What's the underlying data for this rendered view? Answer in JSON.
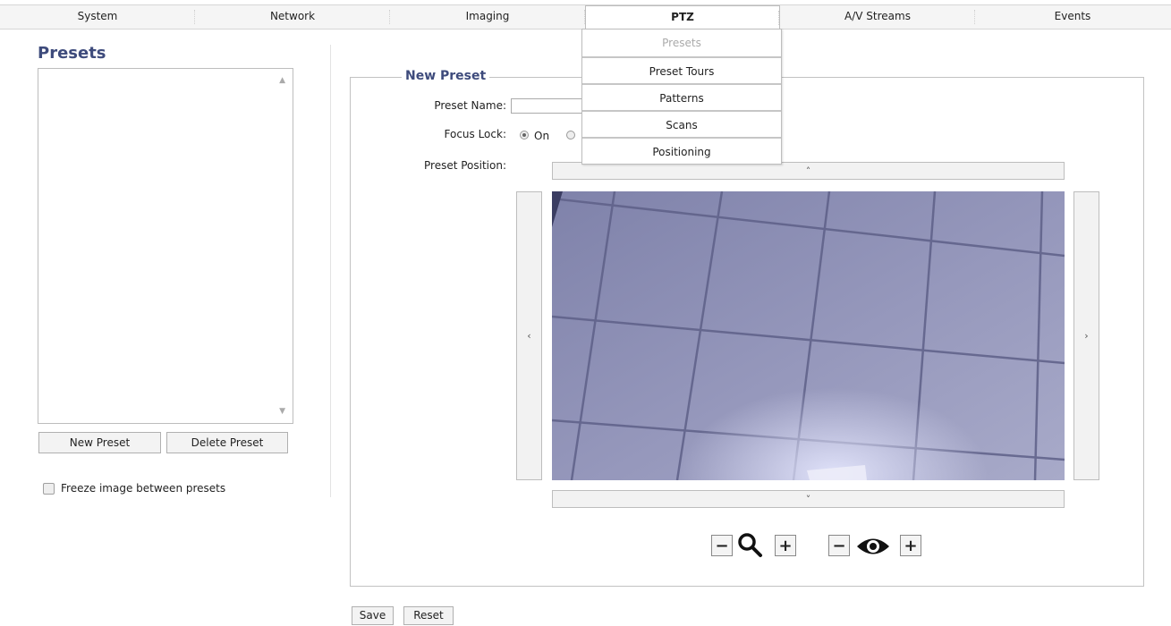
{
  "nav": {
    "tabs": [
      {
        "label": "System"
      },
      {
        "label": "Network"
      },
      {
        "label": "Imaging"
      },
      {
        "label": "PTZ",
        "active": true
      },
      {
        "label": "A/V Streams"
      },
      {
        "label": "Events"
      }
    ]
  },
  "ptz_menu": {
    "items": [
      "Presets",
      "Preset Tours",
      "Patterns",
      "Scans",
      "Positioning"
    ],
    "disabled_item": "Presets"
  },
  "left": {
    "title": "Presets",
    "new_button": "New Preset",
    "delete_button": "Delete Preset",
    "freeze_label": "Freeze image between presets",
    "freeze_checked": false
  },
  "form": {
    "legend": "New Preset",
    "name_label": "Preset Name:",
    "name_value": "",
    "focus_label": "Focus Lock:",
    "focus_on_label": "On",
    "focus_on_selected": true,
    "position_label": "Preset Position:"
  },
  "controls": {
    "up": "˄",
    "down": "˅",
    "left": "‹",
    "right": "›",
    "minus": "−",
    "plus": "+",
    "zoom_icon": "magnifier-icon",
    "focus_icon": "eye-icon"
  },
  "actions": {
    "save": "Save",
    "reset": "Reset"
  },
  "colors": {
    "heading": "#3e4b7c",
    "camera_tint": "#8d8fb4"
  }
}
